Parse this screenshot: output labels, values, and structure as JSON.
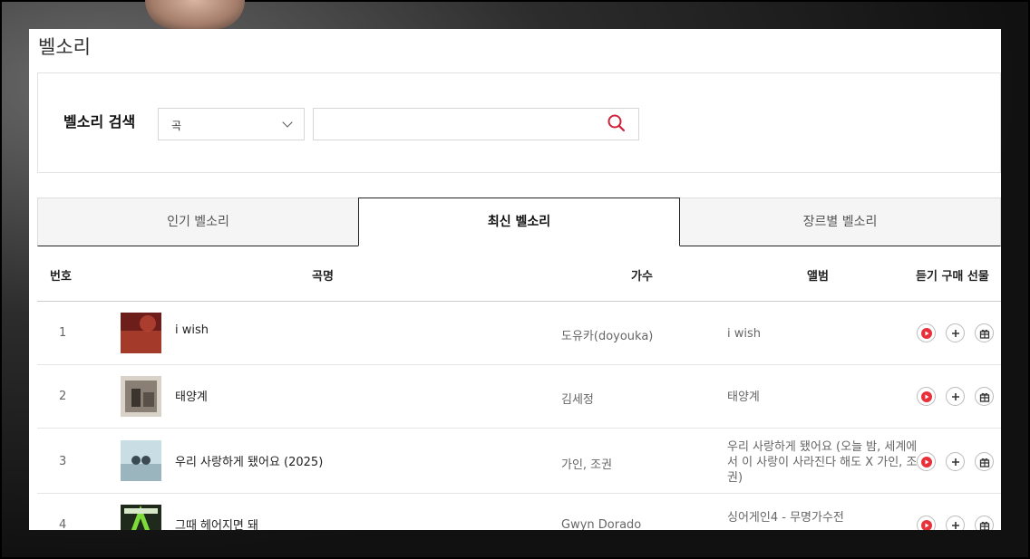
{
  "page": {
    "title": "벨소리"
  },
  "search": {
    "label": "벨소리 검색",
    "select_value": "곡",
    "input_value": "",
    "placeholder": ""
  },
  "tabs": [
    {
      "label": "인기 벨소리",
      "active": false
    },
    {
      "label": "최신 벨소리",
      "active": true
    },
    {
      "label": "장르별 벨소리",
      "active": false
    }
  ],
  "table": {
    "headers": {
      "num": "번호",
      "title": "곡명",
      "artist": "가수",
      "album": "앨범",
      "actions": "듣기 구매 선물"
    },
    "rows": [
      {
        "num": "1",
        "title": "i wish",
        "artist": "도유카(doyouka)",
        "album": "i wish",
        "cover_color": "#8a2a24"
      },
      {
        "num": "2",
        "title": "태양계",
        "artist": "김세정",
        "album": "태양계",
        "cover_color": "#6e6560"
      },
      {
        "num": "3",
        "title": "우리 사랑하게 됐어요 (2025)",
        "artist": "가인, 조권",
        "album": "우리 사랑하게 됐어요 (오늘 밤, 세계에서 이 사랑이 사라진다 해도 X 가인, 조권)",
        "cover_color": "#b8cfd8"
      },
      {
        "num": "4",
        "title": "그때 헤어지면 돼",
        "artist": "Gwyn Dorado",
        "album": "싱어게인4 - 무명가수전",
        "cover_color": "#1f2a1c"
      }
    ]
  },
  "colors": {
    "accent": "#d0223a",
    "play": "#e8303a"
  }
}
